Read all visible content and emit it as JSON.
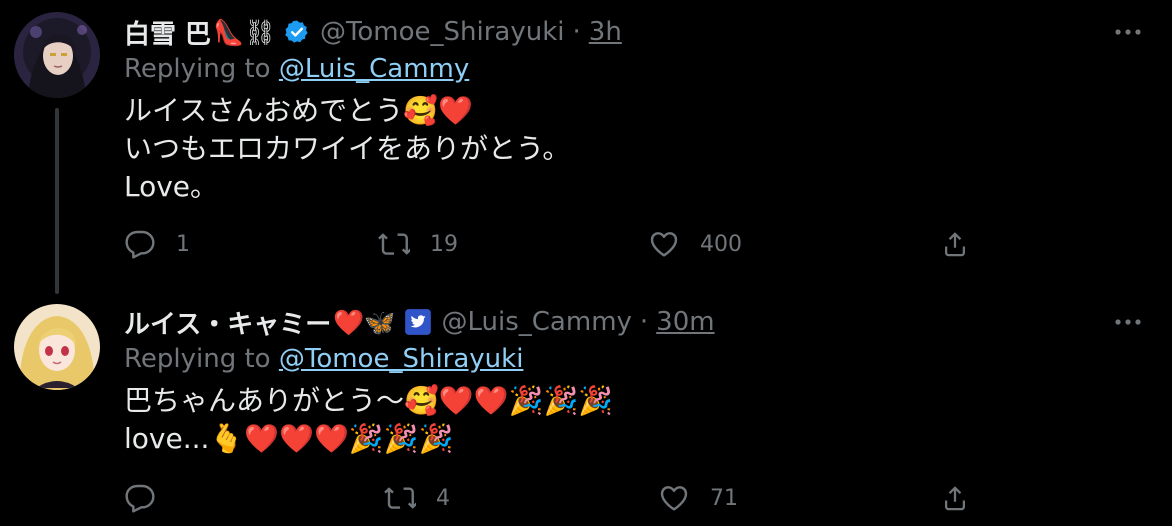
{
  "tweets": [
    {
      "display_name": "白雪 巴",
      "name_emojis": "👠⛓",
      "badge": "verified-blue-check",
      "handle": "@Tomoe_Shirayuki",
      "separator": "·",
      "time": "3h",
      "replying_prefix": "Replying to ",
      "replying_to": "@Luis_Cammy",
      "text_lines": [
        "ルイスさんおめでとう🥰❤️",
        "いつもエロカワイイをありがとう。",
        "Love。"
      ],
      "actions": {
        "reply": "1",
        "retweet": "19",
        "like": "400"
      }
    },
    {
      "display_name": "ルイス・キャミー",
      "name_emojis": "❤️🦋",
      "badge": "twitter-bird-badge",
      "handle": "@Luis_Cammy",
      "separator": "·",
      "time": "30m",
      "replying_prefix": "Replying to ",
      "replying_to": "@Tomoe_Shirayuki",
      "text_lines": [
        "巴ちゃんありがとう〜🥰❤️❤️🎉🎉🎉",
        "love...🫰❤️❤️❤️🎉🎉🎉"
      ],
      "actions": {
        "reply": "",
        "retweet": "4",
        "like": "71"
      }
    }
  ],
  "colors": {
    "background": "#000000",
    "text": "#e7e9ea",
    "muted": "#71767b",
    "link": "#8fcff6",
    "verified": "#1d9bf0"
  }
}
